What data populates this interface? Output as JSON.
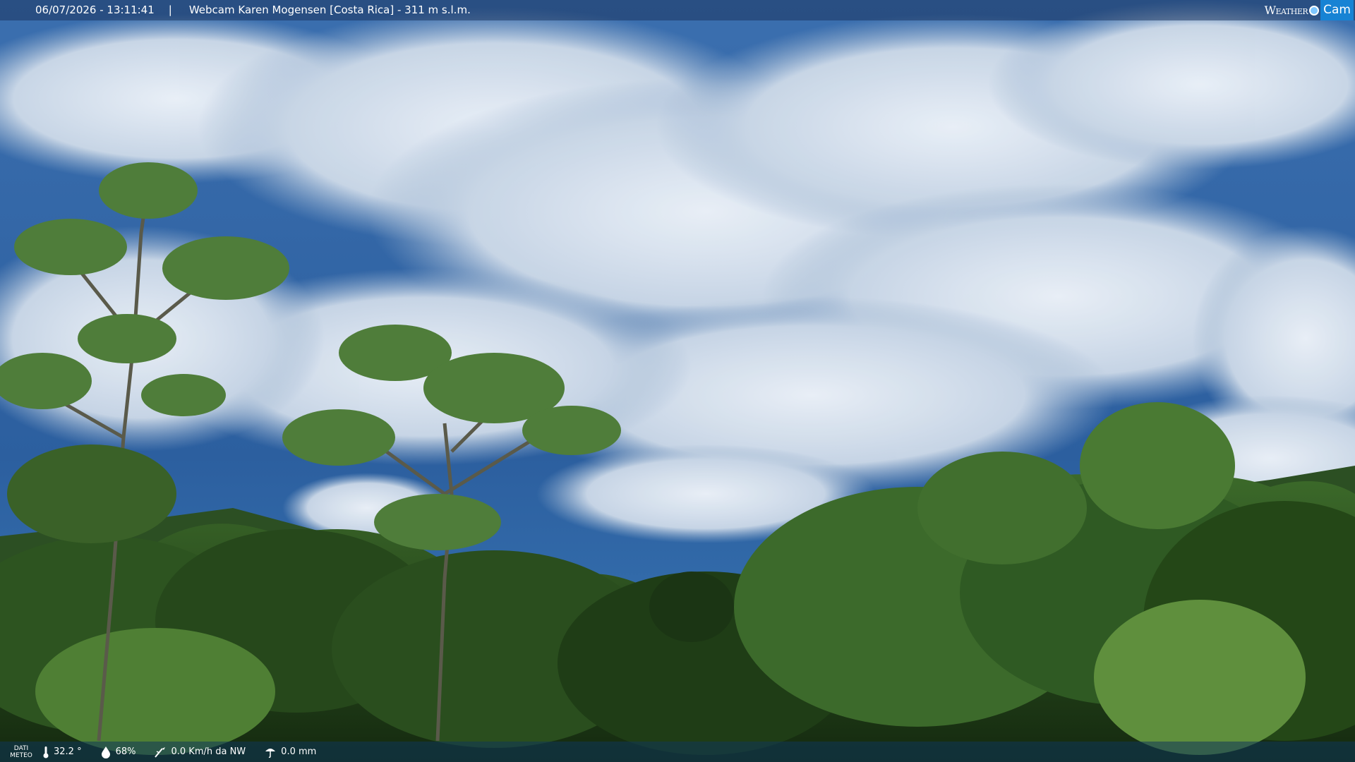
{
  "header": {
    "timestamp": "06/07/2026 - 13:11:41",
    "separator": "|",
    "title": "Webcam Karen Mogensen [Costa Rica]  - 311 m s.l.m.",
    "logo_word": "Weather",
    "logo_cam": "Cam"
  },
  "footer": {
    "label_line1": "DATI",
    "label_line2": "METEO",
    "temperature": "32.2 °",
    "humidity": "68%",
    "wind": "0.0 Km/h da NW",
    "rain": "0.0 mm"
  },
  "colors": {
    "sky": "#2f64a8",
    "cloud": "#e7eef6",
    "foliage_dark": "#1b3a17",
    "foliage_mid": "#3f6e2a",
    "foliage_light": "#7fa850"
  },
  "icons": {
    "temperature": "thermometer-icon",
    "humidity": "droplet-icon",
    "wind": "wind-icon",
    "rain": "rain-icon"
  }
}
